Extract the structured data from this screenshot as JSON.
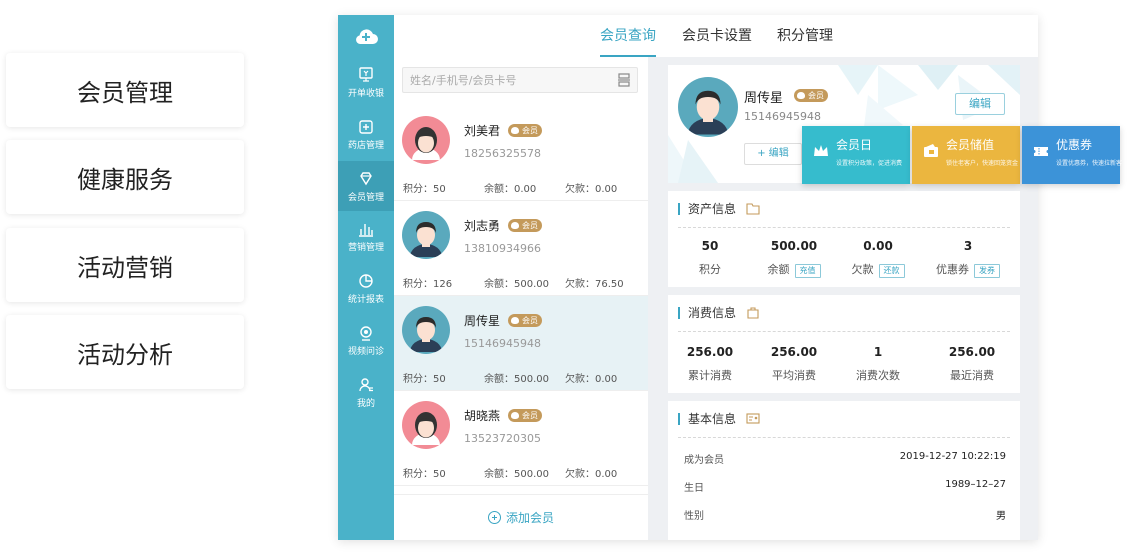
{
  "features": [
    "会员管理",
    "健康服务",
    "活动营销",
    "活动分析"
  ],
  "colors": {
    "accent": "#3aa5c3",
    "rail": "#4ab2c9",
    "badge": "#c49a5b",
    "promo_teal": "#36bccd",
    "promo_gold": "#ebb63f",
    "promo_blue": "#3c93d8"
  },
  "rail": [
    {
      "label": "开单收银",
      "icon": "cashier-icon"
    },
    {
      "label": "药店管理",
      "icon": "pharmacy-icon"
    },
    {
      "label": "会员管理",
      "icon": "diamond-icon"
    },
    {
      "label": "营销管理",
      "icon": "bar-chart-icon"
    },
    {
      "label": "统计报表",
      "icon": "pie-chart-icon"
    },
    {
      "label": "视频问诊",
      "icon": "camera-icon"
    },
    {
      "label": "我的",
      "icon": "user-icon"
    }
  ],
  "tabs": [
    "会员查询",
    "会员卡设置",
    "积分管理"
  ],
  "search": {
    "placeholder": "姓名/手机号/会员卡号"
  },
  "member_badge": "会员",
  "stat_labels": {
    "points": "积分：",
    "balance": "余额：",
    "debt": "欠款："
  },
  "members": [
    {
      "name": "刘美君",
      "phone": "18256325578",
      "points": "50",
      "balance": "0.00",
      "debt": "0.00",
      "gender": "female"
    },
    {
      "name": "刘志勇",
      "phone": "13810934966",
      "points": "126",
      "balance": "500.00",
      "debt": "76.50",
      "gender": "male"
    },
    {
      "name": "周传星",
      "phone": "15146945948",
      "points": "50",
      "balance": "500.00",
      "debt": "0.00",
      "gender": "male"
    },
    {
      "name": "胡晓燕",
      "phone": "13523720305",
      "points": "50",
      "balance": "500.00",
      "debt": "0.00",
      "gender": "female"
    }
  ],
  "add_member": "添加会员",
  "profile": {
    "name": "周传星",
    "phone": "15146945948",
    "edit": "编辑",
    "edit2": "+ 编辑"
  },
  "promos": [
    {
      "title": "会员日",
      "sub": "设置积分政策，促进消费",
      "icon": "crown-icon"
    },
    {
      "title": "会员储值",
      "sub": "锁住老客户，快速回笼资金",
      "icon": "wallet-icon"
    },
    {
      "title": "优惠券",
      "sub": "设置优惠券，快速拉新客",
      "icon": "coupon-icon"
    }
  ],
  "assets": {
    "title": "资产信息",
    "items": [
      {
        "value": "50",
        "label": "积分",
        "action": ""
      },
      {
        "value": "500.00",
        "label": "余额",
        "action": "充值"
      },
      {
        "value": "0.00",
        "label": "欠款",
        "action": "还款"
      },
      {
        "value": "3",
        "label": "优惠券",
        "action": "发券"
      }
    ]
  },
  "consumption": {
    "title": "消费信息",
    "items": [
      {
        "value": "256.00",
        "label": "累计消费"
      },
      {
        "value": "256.00",
        "label": "平均消费"
      },
      {
        "value": "1",
        "label": "消费次数"
      },
      {
        "value": "256.00",
        "label": "最近消费"
      }
    ]
  },
  "basic": {
    "title": "基本信息",
    "rows": [
      {
        "label": "成为会员",
        "value": "2019-12-27 10:22:19"
      },
      {
        "label": "生日",
        "value": "1989–12–27"
      },
      {
        "label": "性别",
        "value": "男"
      }
    ]
  }
}
